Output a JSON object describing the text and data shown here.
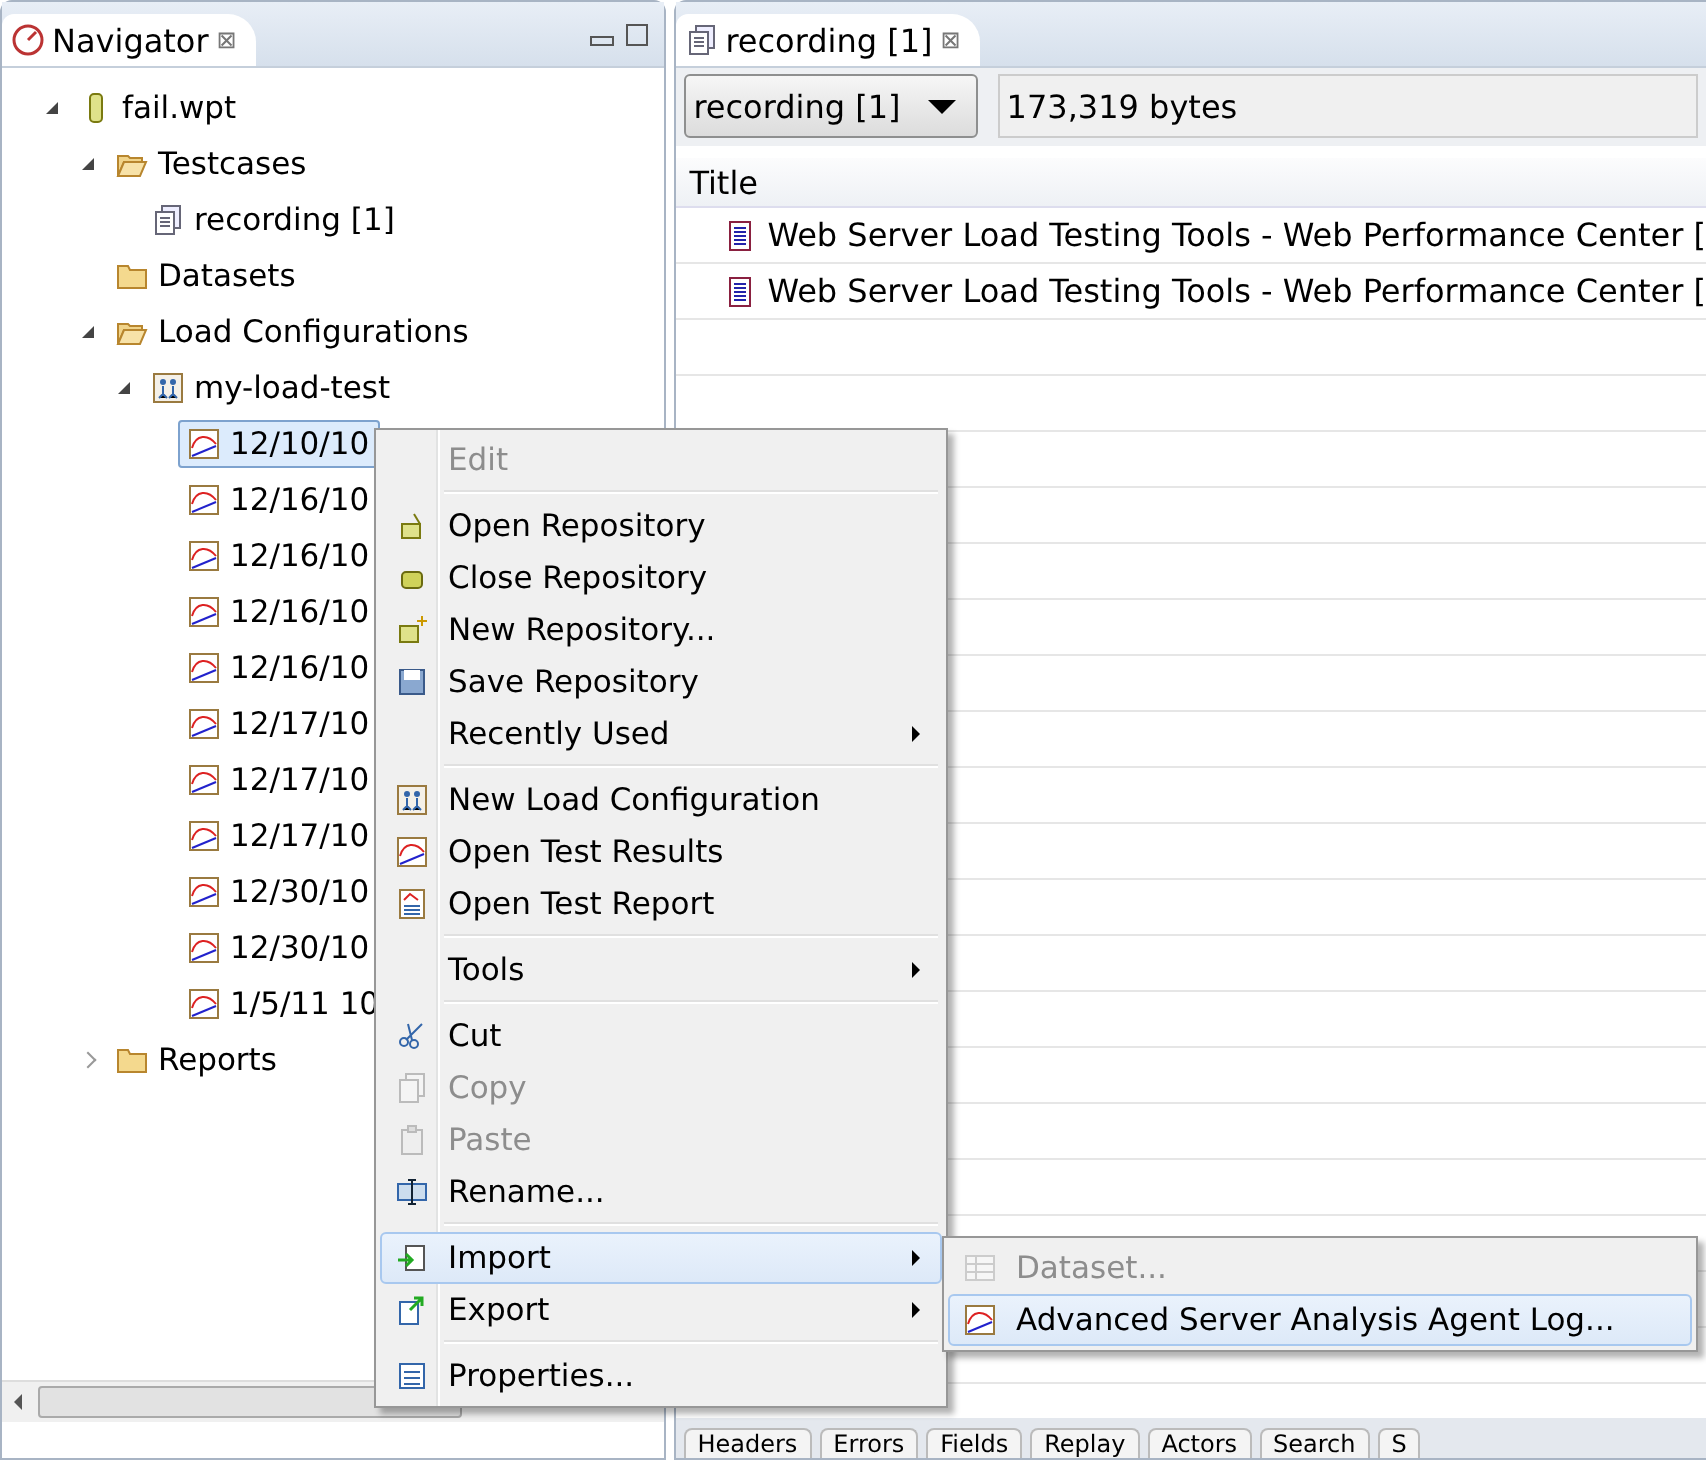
{
  "navigator": {
    "title": "Navigator",
    "close": "⊠",
    "tree": [
      {
        "label": "fail.wpt",
        "kind": "repository",
        "expanded": true,
        "selected": false,
        "children": [
          {
            "label": "Testcases",
            "kind": "folder-open",
            "expanded": true,
            "selected": false,
            "children": [
              {
                "label": "recording [1]",
                "kind": "pages",
                "selected": false
              }
            ]
          },
          {
            "label": "Datasets",
            "kind": "folder",
            "selected": false
          },
          {
            "label": "Load Configurations",
            "kind": "folder-open",
            "expanded": true,
            "selected": false,
            "children": [
              {
                "label": "my-load-test",
                "kind": "people",
                "expanded": true,
                "selected": false,
                "children": [
                  {
                    "label": "12/10/10",
                    "kind": "chart",
                    "selected": true
                  },
                  {
                    "label": "12/16/10",
                    "kind": "chart",
                    "selected": false
                  },
                  {
                    "label": "12/16/10",
                    "kind": "chart",
                    "selected": false
                  },
                  {
                    "label": "12/16/10",
                    "kind": "chart",
                    "selected": false
                  },
                  {
                    "label": "12/16/10",
                    "kind": "chart",
                    "selected": false
                  },
                  {
                    "label": "12/17/10",
                    "kind": "chart",
                    "selected": false
                  },
                  {
                    "label": "12/17/10",
                    "kind": "chart",
                    "selected": false
                  },
                  {
                    "label": "12/17/10",
                    "kind": "chart",
                    "selected": false
                  },
                  {
                    "label": "12/30/10",
                    "kind": "chart",
                    "selected": false
                  },
                  {
                    "label": "12/30/10",
                    "kind": "chart",
                    "selected": false
                  },
                  {
                    "label": "1/5/11 10",
                    "kind": "chart",
                    "selected": false
                  }
                ]
              }
            ]
          },
          {
            "label": "Reports",
            "kind": "folder",
            "expanded": false,
            "selected": false
          }
        ]
      }
    ]
  },
  "editor": {
    "tab": {
      "title": "recording [1]",
      "close": "⊠"
    },
    "dropdown": {
      "value": "recording [1]"
    },
    "size_field": {
      "value": "173,319 bytes"
    },
    "table": {
      "columns": [
        "Title"
      ],
      "rows": [
        {
          "title": "Web Server Load Testing Tools - Web Performance Center ["
        },
        {
          "title": "Web Server Load Testing Tools - Web Performance Center ["
        }
      ]
    },
    "bottom_tabs": [
      {
        "label": "Headers"
      },
      {
        "label": "Errors"
      },
      {
        "label": "Fields"
      },
      {
        "label": "Replay"
      },
      {
        "label": "Actors"
      },
      {
        "label": "Search"
      },
      {
        "label": "S"
      }
    ]
  },
  "context_menu": {
    "items": [
      {
        "kind": "plain",
        "label": "Edit",
        "disabled": true,
        "submenu": false,
        "selected": false
      },
      {
        "kind": "separator"
      },
      {
        "kind": "repo-open",
        "label": "Open Repository",
        "disabled": false,
        "submenu": false,
        "selected": false
      },
      {
        "kind": "repo-closed",
        "label": "Close Repository",
        "disabled": false,
        "submenu": false,
        "selected": false
      },
      {
        "kind": "repo-new",
        "label": "New Repository...",
        "disabled": false,
        "submenu": false,
        "selected": false
      },
      {
        "kind": "save",
        "label": "Save Repository",
        "disabled": false,
        "submenu": false,
        "selected": false
      },
      {
        "kind": "plain",
        "label": "Recently Used",
        "disabled": false,
        "submenu": true,
        "selected": false
      },
      {
        "kind": "separator"
      },
      {
        "kind": "people",
        "label": "New Load Configuration",
        "disabled": false,
        "submenu": false,
        "selected": false
      },
      {
        "kind": "chart",
        "label": "Open Test Results",
        "disabled": false,
        "submenu": false,
        "selected": false
      },
      {
        "kind": "report",
        "label": "Open Test Report",
        "disabled": false,
        "submenu": false,
        "selected": false
      },
      {
        "kind": "separator"
      },
      {
        "kind": "plain",
        "label": "Tools",
        "disabled": false,
        "submenu": true,
        "selected": false
      },
      {
        "kind": "separator"
      },
      {
        "kind": "scissors",
        "label": "Cut",
        "disabled": false,
        "submenu": false,
        "selected": false
      },
      {
        "kind": "copy",
        "label": "Copy",
        "disabled": true,
        "submenu": false,
        "selected": false
      },
      {
        "kind": "paste",
        "label": "Paste",
        "disabled": true,
        "submenu": false,
        "selected": false
      },
      {
        "kind": "rename",
        "label": "Rename...",
        "disabled": false,
        "submenu": false,
        "selected": false
      },
      {
        "kind": "separator"
      },
      {
        "kind": "import",
        "label": "Import",
        "disabled": false,
        "submenu": true,
        "selected": true
      },
      {
        "kind": "export",
        "label": "Export",
        "disabled": false,
        "submenu": true,
        "selected": false
      },
      {
        "kind": "separator"
      },
      {
        "kind": "properties",
        "label": "Properties...",
        "disabled": false,
        "submenu": false,
        "selected": false
      }
    ]
  },
  "submenu": {
    "items": [
      {
        "kind": "grid",
        "label": "Dataset...",
        "disabled": true,
        "selected": false
      },
      {
        "kind": "chart",
        "label": "Advanced Server Analysis Agent Log...",
        "disabled": false,
        "selected": true
      }
    ]
  }
}
